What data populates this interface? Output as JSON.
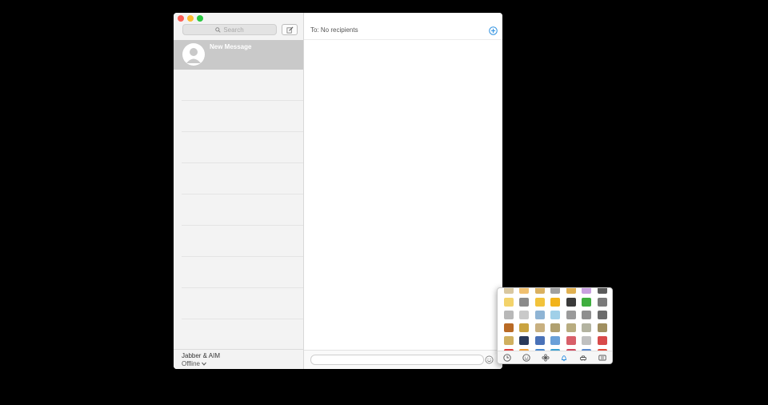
{
  "sidebar": {
    "search_placeholder": "Search",
    "conversations": [
      {
        "name": "New Message",
        "selected": true
      }
    ],
    "empty_rows": 9,
    "footer": {
      "account": "Jabber & AIM",
      "status": "Offline"
    }
  },
  "main": {
    "to_label": "To: No recipients",
    "message_value": ""
  },
  "emoji_picker": {
    "rows": [
      [
        "#d8c7a0",
        "#f0c070",
        "#d9b060",
        "#a0a0a0",
        "#e0b050",
        "#c9a0e0",
        "#5a5a5a"
      ],
      [
        "#f3d36b",
        "#8a8a8a",
        "#f2c33b",
        "#f2b31b",
        "#3a3a3a",
        "#3fae3f",
        "#7a7a7a"
      ],
      [
        "#b8b8b8",
        "#c9c9c9",
        "#8fb4d4",
        "#a0d0e8",
        "#9a9a9a",
        "#8f8f8f",
        "#6b6b6b"
      ],
      [
        "#b96a25",
        "#c9a340",
        "#c8b080",
        "#b0a070",
        "#b8ac80",
        "#b3b3a0",
        "#a08f60"
      ],
      [
        "#d0b060",
        "#2a3a5a",
        "#4a72b8",
        "#6aa0d8",
        "#d8606a",
        "#c0c0c0",
        "#d84a4a"
      ],
      [
        "#e04040",
        "#f2a03a",
        "#4a8ad0",
        "#3aa0d0",
        "#d04a60",
        "#5a8ad0",
        "#e04a3a"
      ]
    ],
    "categories": [
      "clock-icon",
      "smiley-icon",
      "flower-icon",
      "bell-icon",
      "car-icon",
      "symbols-icon"
    ],
    "selected_category": "clock-icon",
    "accent": "#2b8fe0"
  }
}
